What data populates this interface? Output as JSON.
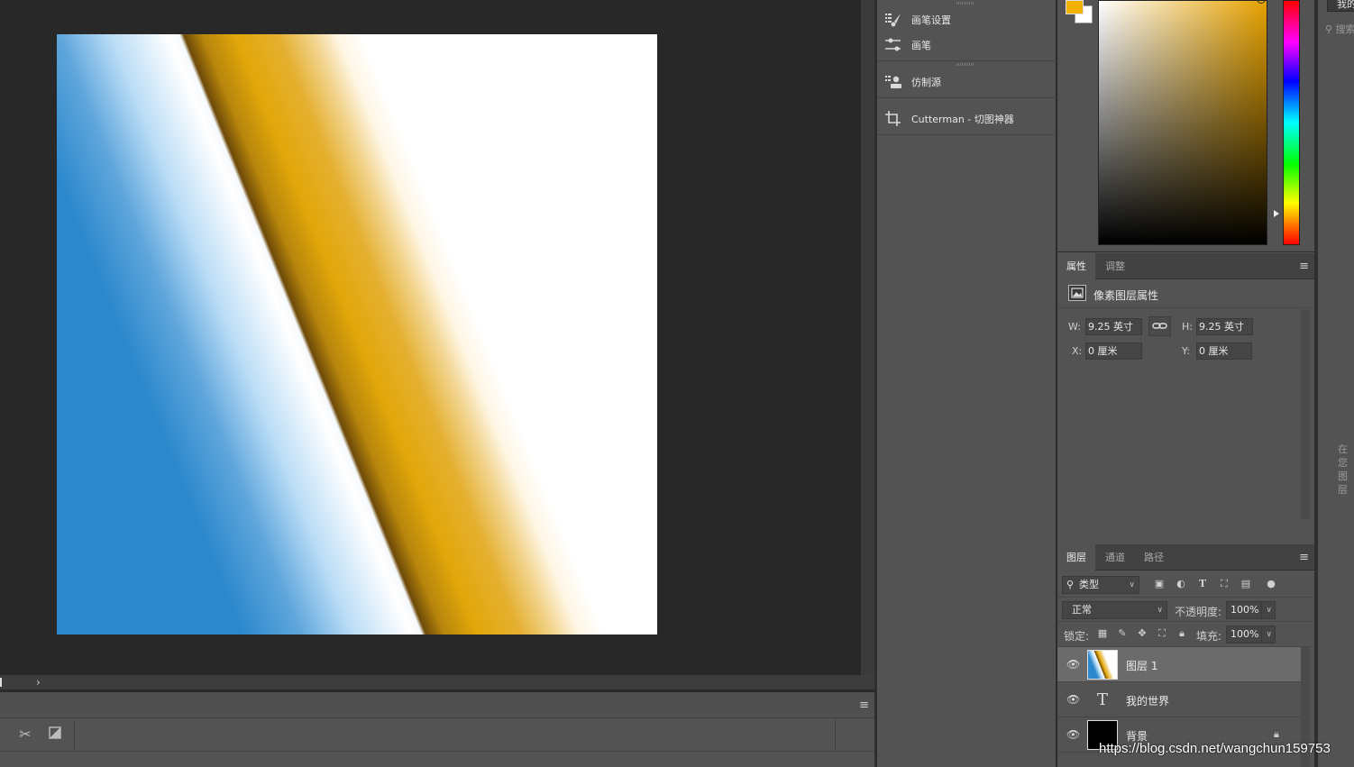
{
  "dock": {
    "items": [
      {
        "label": "画笔设置",
        "icon": "brush-settings-icon"
      },
      {
        "label": "画笔",
        "icon": "brush-icon"
      },
      {
        "label": "仿制源",
        "icon": "clone-source-icon"
      },
      {
        "label": "Cutterman - 切图神器",
        "icon": "crop-icon"
      }
    ]
  },
  "color": {
    "foreground": "#f4b100",
    "background": "#ffffff"
  },
  "properties": {
    "tabs": [
      {
        "label": "属性",
        "active": true
      },
      {
        "label": "调整",
        "active": false
      }
    ],
    "title": "像素图层属性",
    "w_label": "W:",
    "w_value": "9.25 英寸",
    "h_label": "H:",
    "h_value": "9.25 英寸",
    "x_label": "X:",
    "x_value": "0 厘米",
    "y_label": "Y:",
    "y_value": "0 厘米"
  },
  "layers": {
    "tabs": [
      {
        "label": "图层",
        "active": true
      },
      {
        "label": "通道",
        "active": false
      },
      {
        "label": "路径",
        "active": false
      }
    ],
    "filter_label": "类型",
    "blend_mode": "正常",
    "opacity_label": "不透明度:",
    "opacity_value": "100%",
    "lock_label": "锁定:",
    "fill_label": "填充:",
    "fill_value": "100%",
    "items": [
      {
        "name": "图层 1",
        "selected": true,
        "kind": "pixel"
      },
      {
        "name": "我的世界",
        "selected": false,
        "kind": "text"
      },
      {
        "name": "背景",
        "selected": false,
        "kind": "background"
      }
    ]
  },
  "far_right": {
    "button": "我的",
    "search": "搜索",
    "hint": "在您图层"
  },
  "watermark": "https://blog.csdn.net/wangchun159753"
}
